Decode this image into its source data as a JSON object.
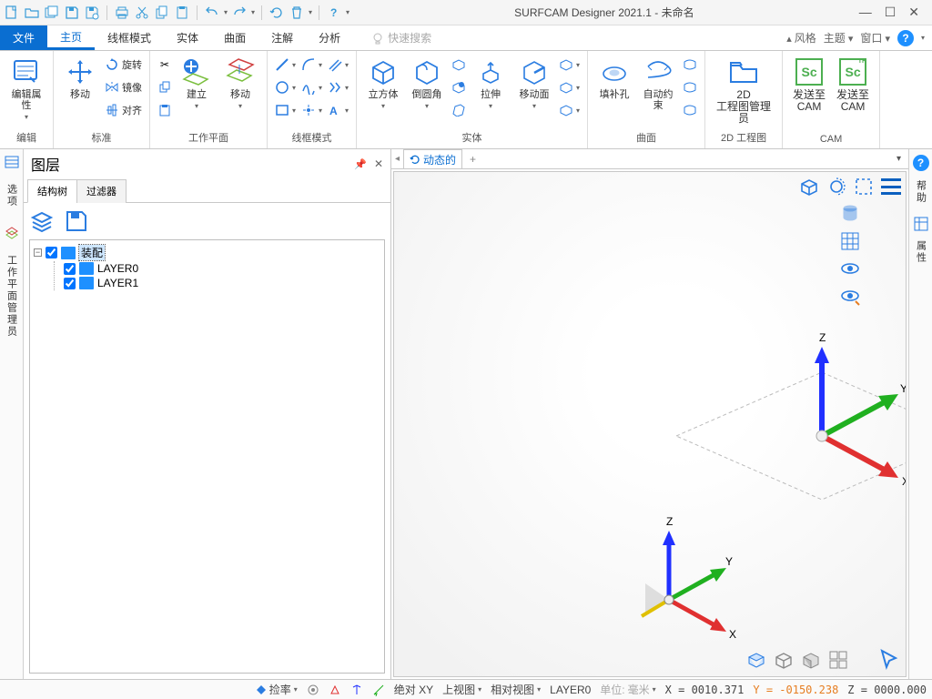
{
  "titlebar": {
    "app": "SURFCAM Designer 2021.1",
    "doc": "未命名"
  },
  "qat": [
    "new",
    "open",
    "save-multi",
    "save",
    "save-as",
    "print",
    "cut",
    "copy",
    "paste",
    "undo",
    "redo",
    "refresh",
    "delete",
    "help"
  ],
  "ribbon_tabs": {
    "file": "文件",
    "tabs": [
      "主页",
      "线框模式",
      "实体",
      "曲面",
      "注解",
      "分析"
    ],
    "active": 0
  },
  "ribbon_right": {
    "style": "风格",
    "theme": "主题",
    "window": "窗口"
  },
  "search_placeholder": "快速搜索",
  "groups": {
    "edit": {
      "title": "编辑",
      "edit_attr": "编辑属性",
      "move": "移动",
      "rotate": "旋转",
      "mirror": "镜像",
      "align": "对齐",
      "standard": "标准"
    },
    "wp": {
      "title": "工作平面",
      "build": "建立",
      "move2": "移动"
    },
    "wire": {
      "title": "线框模式"
    },
    "solid": {
      "title": "实体",
      "cube": "立方体",
      "fillet": "倒圆角",
      "extrude": "拉伸",
      "moveface": "移动面"
    },
    "surf": {
      "title": "曲面",
      "fill": "填补孔",
      "constrain": "自动约束"
    },
    "dwg": {
      "title": "2D 工程图",
      "mgr1": "2D",
      "mgr2": "工程图管理员"
    },
    "cam": {
      "title": "CAM",
      "send1": "发送至",
      "send2": "CAM"
    }
  },
  "left_tabs": [
    "选项",
    "工作平面管理员"
  ],
  "panel": {
    "title": "图层",
    "tabs": [
      "结构树",
      "过滤器"
    ],
    "root": "装配",
    "layers": [
      "LAYER0",
      "LAYER1"
    ]
  },
  "viewport_tab": "动态的",
  "right_tabs": [
    "帮助",
    "属性"
  ],
  "status": {
    "snap": "捡率",
    "abs": "绝对 XY",
    "topview": "上视图",
    "relview": "相对视图",
    "layer": "LAYER0",
    "unit_lab": "单位:",
    "unit": "毫米",
    "x": "X = 0010.371",
    "y": "Y = -0150.238",
    "z": "Z = 0000.000"
  },
  "axes": {
    "x": "X",
    "y": "Y",
    "z": "Z"
  }
}
